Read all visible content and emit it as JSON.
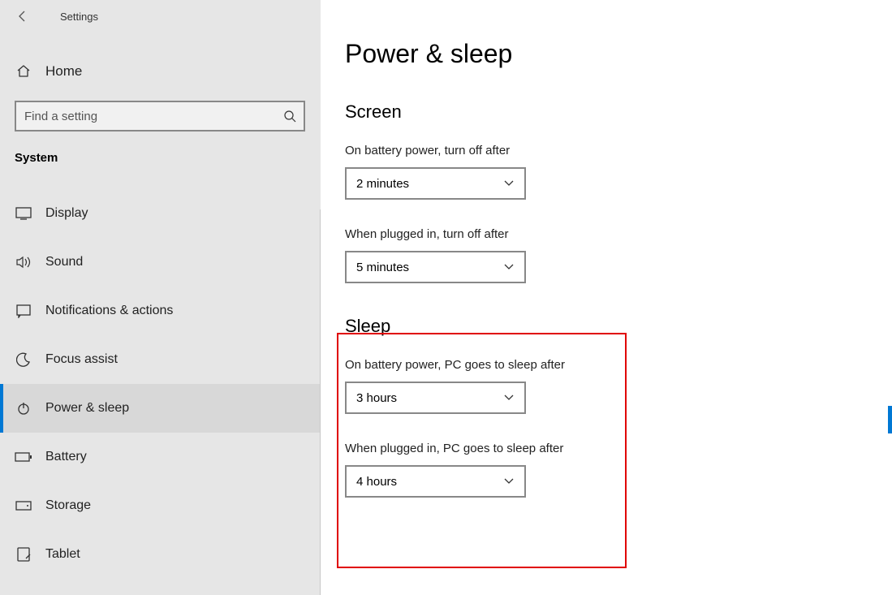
{
  "header": {
    "title": "Settings"
  },
  "home": {
    "label": "Home"
  },
  "search": {
    "placeholder": "Find a setting"
  },
  "sectionLabel": "System",
  "nav": {
    "display": "Display",
    "sound": "Sound",
    "notifications": "Notifications & actions",
    "focus": "Focus assist",
    "power": "Power & sleep",
    "battery": "Battery",
    "storage": "Storage",
    "tablet": "Tablet"
  },
  "main": {
    "title": "Power & sleep",
    "screen": {
      "heading": "Screen",
      "batteryLabel": "On battery power, turn off after",
      "batteryValue": "2 minutes",
      "pluggedLabel": "When plugged in, turn off after",
      "pluggedValue": "5 minutes"
    },
    "sleep": {
      "heading": "Sleep",
      "batteryLabel": "On battery power, PC goes to sleep after",
      "batteryValue": "3 hours",
      "pluggedLabel": "When plugged in, PC goes to sleep after",
      "pluggedValue": "4 hours"
    }
  }
}
